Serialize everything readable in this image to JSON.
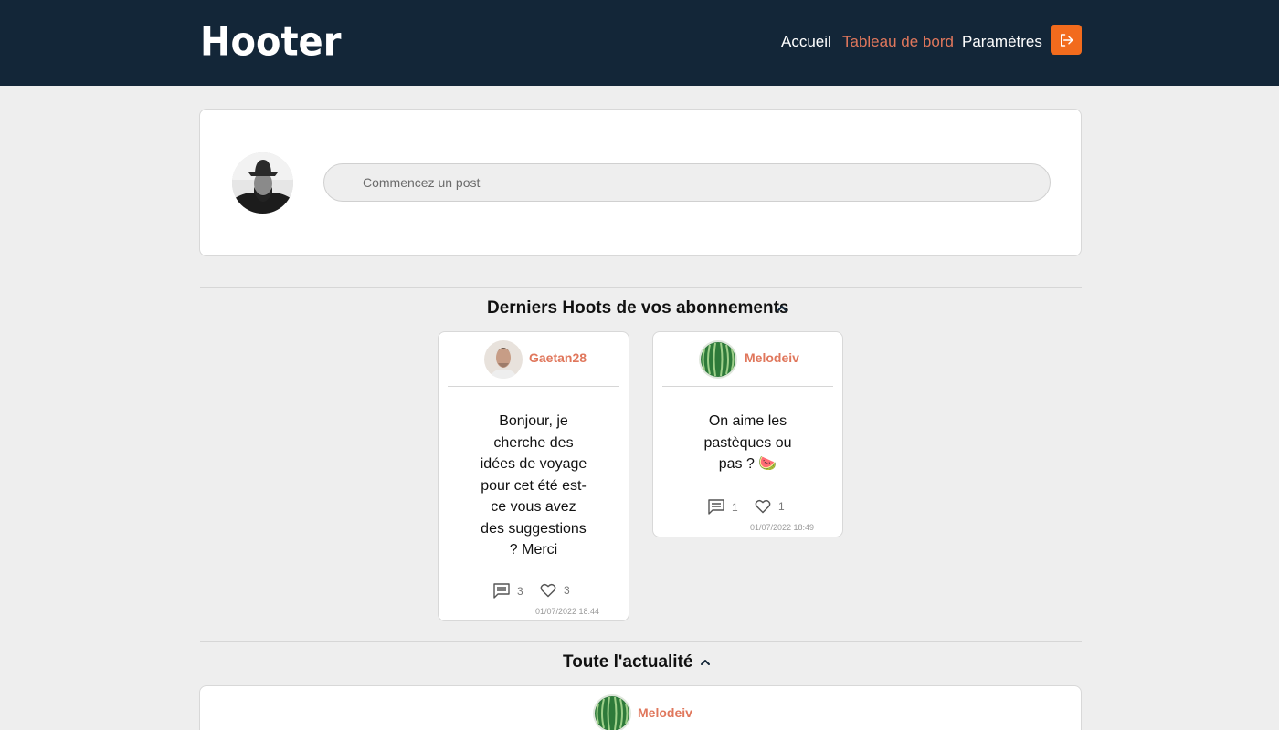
{
  "header": {
    "logo": "Hooter",
    "nav": [
      "Accueil",
      "Tableau de bord",
      "Paramètres"
    ],
    "active_nav": "Tableau de bord",
    "logout_icon": "logout-icon",
    "colors": {
      "bar": "#132638",
      "accent": "#e0775c",
      "button": "#f26b1d"
    }
  },
  "composer": {
    "placeholder": "Commencez un post",
    "avatar_icon": "user-avatar"
  },
  "sections": {
    "following": "Derniers Hoots de vos abonnements",
    "all": "Toute l'actualité"
  },
  "following_posts": [
    {
      "user": "Gaetan28",
      "text": "Bonjour, je cherche des idées de voyage pour cet été est-ce vous avez des suggestions ? Merci",
      "comments": "3",
      "likes": "3",
      "date": "01/07/2022 18:44"
    },
    {
      "user": "Melodeiv",
      "text": "On aime les pastèques ou pas ? 🍉",
      "comments": "1",
      "likes": "1",
      "date": "01/07/2022 18:49"
    }
  ],
  "all_posts": [
    {
      "user": "Melodeiv"
    }
  ]
}
